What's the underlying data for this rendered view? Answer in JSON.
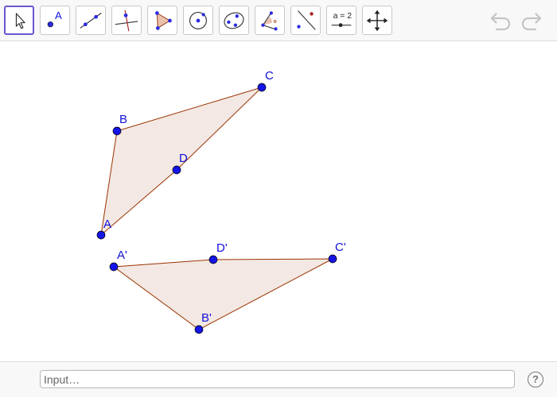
{
  "toolbar": {
    "tools": [
      {
        "name": "Move",
        "icon": "move-arrow-icon",
        "active": true
      },
      {
        "name": "Point",
        "icon": "point-icon",
        "label": "A"
      },
      {
        "name": "Line",
        "icon": "line-icon"
      },
      {
        "name": "Perpendicular Line",
        "icon": "perpendicular-line-icon"
      },
      {
        "name": "Polygon",
        "icon": "polygon-icon"
      },
      {
        "name": "Circle with Center",
        "icon": "circle-center-icon"
      },
      {
        "name": "Conic",
        "icon": "conic-icon"
      },
      {
        "name": "Angle",
        "icon": "angle-icon"
      },
      {
        "name": "Reflect about Line",
        "icon": "reflect-icon"
      },
      {
        "name": "Slider",
        "icon": "slider-icon",
        "label": "a = 2"
      },
      {
        "name": "Move Graphics View",
        "icon": "move-view-icon"
      }
    ],
    "undo_icon": "undo-icon",
    "redo_icon": "redo-icon"
  },
  "canvas": {
    "colors": {
      "point": "#1414e6",
      "edge": "#993300",
      "fill": "#f3e8e3",
      "label": "#1010d8"
    },
    "points": [
      {
        "id": "A",
        "label": "A"
      },
      {
        "id": "B",
        "label": "B"
      },
      {
        "id": "C",
        "label": "C"
      },
      {
        "id": "D",
        "label": "D"
      },
      {
        "id": "A1",
        "label": "A'"
      },
      {
        "id": "B1",
        "label": "B'"
      },
      {
        "id": "C1",
        "label": "C'"
      },
      {
        "id": "D1",
        "label": "D'"
      }
    ]
  },
  "input_bar": {
    "placeholder": "Input…",
    "help_label": "?"
  }
}
